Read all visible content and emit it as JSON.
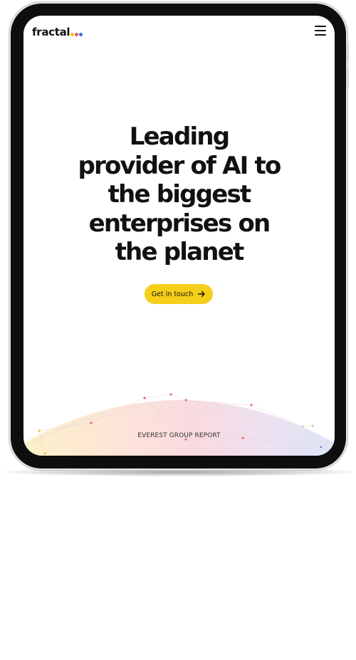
{
  "header": {
    "logo_text": "fractal",
    "logo_dot_colors": [
      "#f2c21b",
      "#e85a5a",
      "#3b6fd8"
    ],
    "menu_icon": "hamburger-menu-icon"
  },
  "hero": {
    "title": "Leading provider of AI to the biggest enterprises on the planet",
    "cta_label": "Get in touch",
    "cta_icon": "arrow-right-icon"
  },
  "globe": {
    "caption": "EVEREST GROUP REPORT"
  },
  "colors": {
    "accent": "#f6cf1a",
    "text": "#111111",
    "bezel": "#0e0e0e"
  }
}
